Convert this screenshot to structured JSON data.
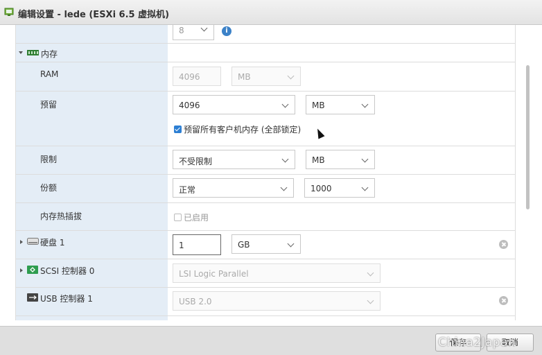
{
  "window": {
    "title": "编辑设置 - lede (ESXi 6.5 虚拟机)"
  },
  "memory": {
    "section_label": "内存",
    "ram": {
      "label": "RAM",
      "value": "4096",
      "unit": "MB"
    },
    "reservation": {
      "label": "预留",
      "value": "4096",
      "unit": "MB",
      "lock_checkbox_label": "预留所有客户机内存 (全部锁定)",
      "lock_checked": true
    },
    "limit": {
      "label": "限制",
      "value": "不受限制",
      "unit": "MB"
    },
    "shares": {
      "label": "份额",
      "value": "正常",
      "amount": "1000"
    },
    "hot_plug": {
      "label": "内存热插拔",
      "checkbox_label": "已启用",
      "checked": false
    }
  },
  "disk": {
    "label": "硬盘 1",
    "size": "1",
    "unit": "GB"
  },
  "scsi": {
    "label": "SCSI 控制器 0",
    "value": "LSI Logic Parallel"
  },
  "usb": {
    "label": "USB 控制器 1",
    "value": "USB 2.0"
  },
  "top_partial": {
    "value": "8"
  },
  "footer": {
    "save_label": "保存",
    "cancel_label": "取消"
  },
  "watermark": "China2Japan",
  "colors": {
    "accent": "#2d7fd3",
    "label_column": "#e4edf6"
  }
}
